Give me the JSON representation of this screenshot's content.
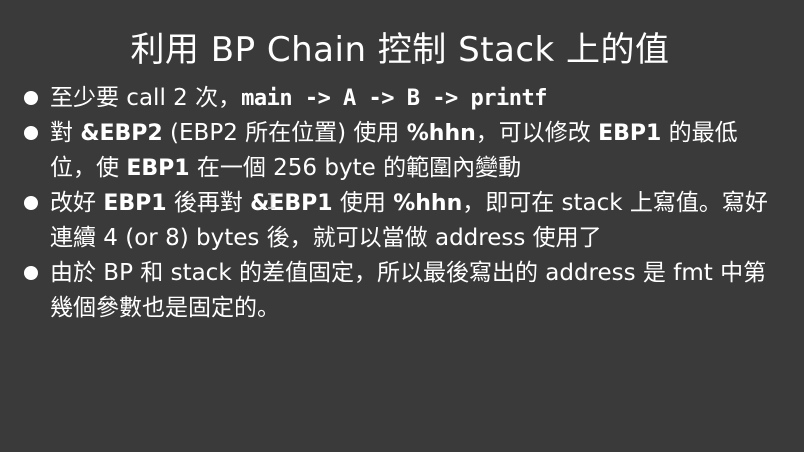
{
  "slide": {
    "title": "利用 BP Chain 控制 Stack 上的值",
    "bullets": [
      {
        "parts": [
          {
            "text": "至少要 call 2 次，",
            "style": "normal"
          },
          {
            "text": "main -> A -> B -> printf",
            "style": "code"
          }
        ]
      },
      {
        "parts": [
          {
            "text": "對 ",
            "style": "normal"
          },
          {
            "text": "&EBP2",
            "style": "bold"
          },
          {
            "text": " (EBP2 所在位置) 使用 ",
            "style": "normal"
          },
          {
            "text": "%hhn",
            "style": "bold"
          },
          {
            "text": "，可以修改 ",
            "style": "normal"
          },
          {
            "text": "EBP1",
            "style": "bold"
          },
          {
            "text": " 的最低位，使 ",
            "style": "normal"
          },
          {
            "text": "EBP1",
            "style": "bold"
          },
          {
            "text": " 在一個 256 byte 的範圍內變動",
            "style": "normal"
          }
        ]
      },
      {
        "parts": [
          {
            "text": "改好 ",
            "style": "normal"
          },
          {
            "text": "EBP1",
            "style": "bold"
          },
          {
            "text": " 後再對 ",
            "style": "normal"
          },
          {
            "text": "&EBP1",
            "style": "bold"
          },
          {
            "text": " 使用 ",
            "style": "normal"
          },
          {
            "text": "%hhn",
            "style": "bold"
          },
          {
            "text": "，即可在 stack 上寫值。寫好連續 4 (or 8) bytes 後，就可以當做 address 使用了",
            "style": "normal"
          }
        ]
      },
      {
        "parts": [
          {
            "text": "由於 BP 和 stack 的差值固定，所以最後寫出的 address 是 fmt 中第幾個參數也是固定的。",
            "style": "normal"
          }
        ]
      }
    ],
    "colors": {
      "background": "#3a3a3a",
      "text": "#ffffff"
    },
    "cursor_icon": "text-cursor-icon"
  }
}
